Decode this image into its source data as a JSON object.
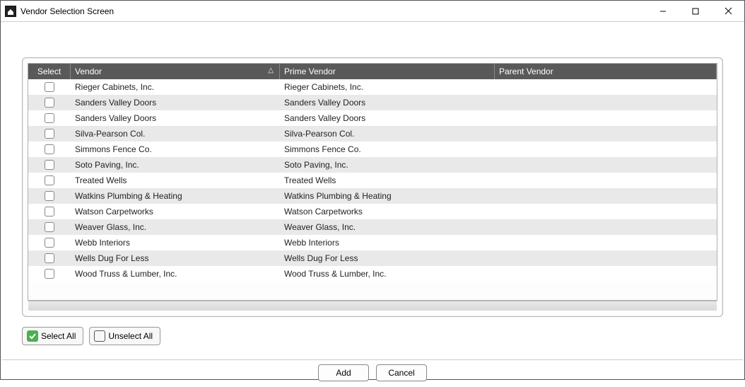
{
  "window": {
    "title": "Vendor Selection Screen"
  },
  "grid": {
    "columns": {
      "select": "Select",
      "vendor": "Vendor",
      "prime": "Prime Vendor",
      "parent": "Parent Vendor"
    },
    "sort_column": "vendor",
    "sort_indicator": "△",
    "rows": [
      {
        "vendor": "Rieger Cabinets, Inc.",
        "prime": "Rieger Cabinets, Inc.",
        "parent": ""
      },
      {
        "vendor": "Sanders Valley Doors",
        "prime": "Sanders Valley Doors",
        "parent": ""
      },
      {
        "vendor": "Sanders Valley Doors",
        "prime": "Sanders Valley Doors",
        "parent": ""
      },
      {
        "vendor": "Silva-Pearson Col.",
        "prime": "Silva-Pearson Col.",
        "parent": ""
      },
      {
        "vendor": "Simmons Fence Co.",
        "prime": "Simmons Fence Co.",
        "parent": ""
      },
      {
        "vendor": "Soto Paving, Inc.",
        "prime": "Soto Paving, Inc.",
        "parent": ""
      },
      {
        "vendor": "Treated Wells",
        "prime": "Treated Wells",
        "parent": ""
      },
      {
        "vendor": "Watkins Plumbing & Heating",
        "prime": "Watkins Plumbing & Heating",
        "parent": ""
      },
      {
        "vendor": "Watson Carpetworks",
        "prime": "Watson Carpetworks",
        "parent": ""
      },
      {
        "vendor": "Weaver Glass, Inc.",
        "prime": "Weaver Glass, Inc.",
        "parent": ""
      },
      {
        "vendor": "Webb Interiors",
        "prime": "Webb Interiors",
        "parent": ""
      },
      {
        "vendor": "Wells Dug For Less",
        "prime": "Wells Dug For Less",
        "parent": ""
      },
      {
        "vendor": "Wood Truss & Lumber, Inc.",
        "prime": "Wood Truss & Lumber, Inc.",
        "parent": ""
      }
    ]
  },
  "buttons": {
    "select_all": "Select All",
    "unselect_all": "Unselect All",
    "add": "Add",
    "cancel": "Cancel"
  }
}
